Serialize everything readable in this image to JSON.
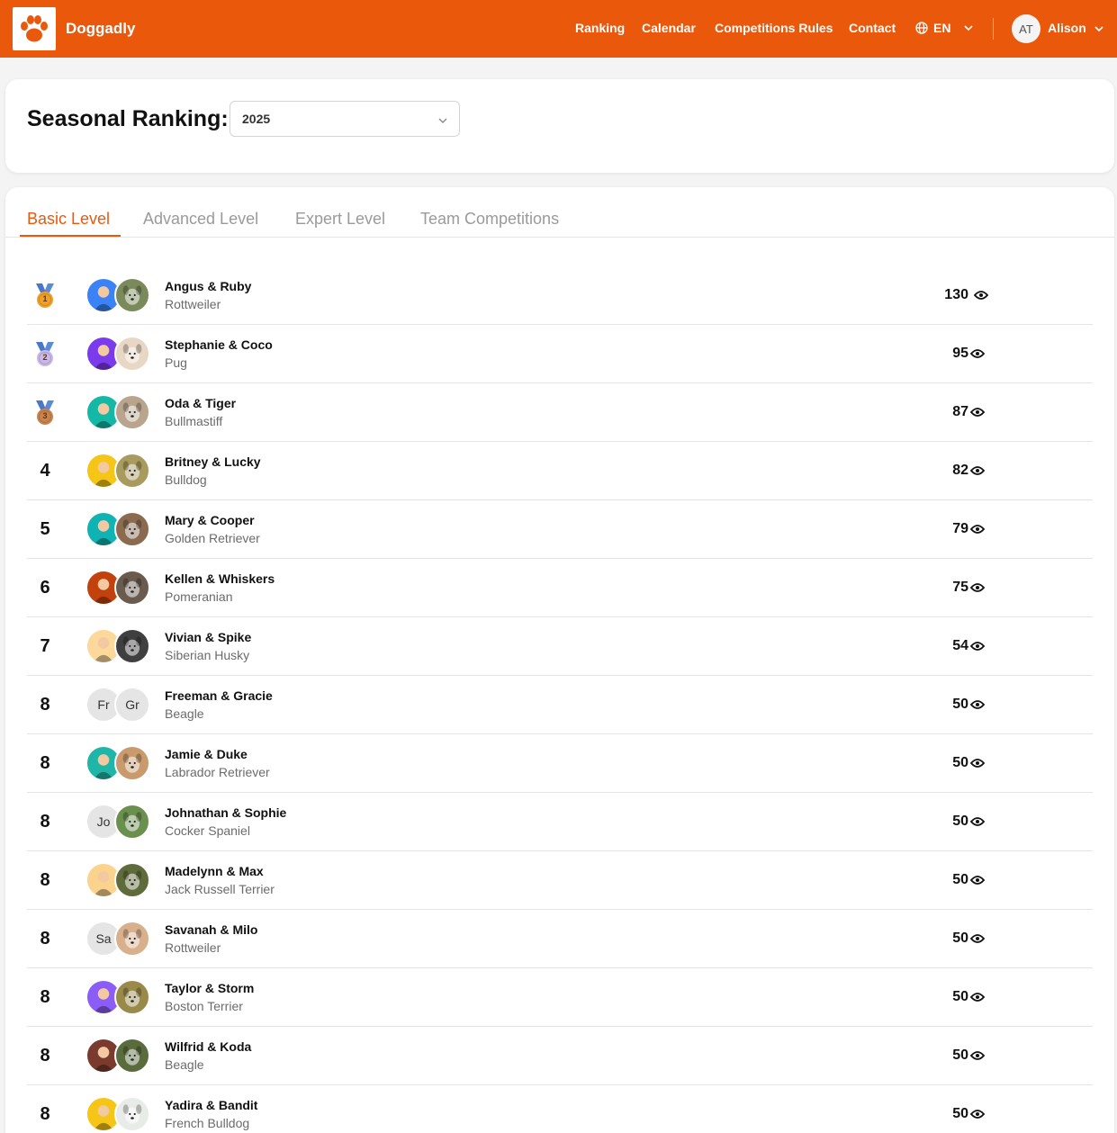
{
  "header": {
    "brand": "Doggadly",
    "nav": [
      "Ranking",
      "Calendar",
      "Competitions Rules",
      "Contact"
    ],
    "language": "EN",
    "user_initials": "AT",
    "user_name": "Alison",
    "accent": "#ea580c"
  },
  "season": {
    "label": "Seasonal Ranking:",
    "selected": "2025"
  },
  "tabs": [
    "Basic Level",
    "Advanced Level",
    "Expert Level",
    "Team Competitions"
  ],
  "active_tab": "Basic Level",
  "rows": [
    {
      "rank": "1",
      "medal": "gold",
      "names": "Angus & Ruby",
      "breed": "Rottweiler",
      "score": "130",
      "owner_initials": "",
      "dog_initials": ""
    },
    {
      "rank": "2",
      "medal": "silver",
      "names": "Stephanie & Coco",
      "breed": "Pug",
      "score": "95",
      "owner_initials": "",
      "dog_initials": ""
    },
    {
      "rank": "3",
      "medal": "bronze",
      "names": "Oda & Tiger",
      "breed": "Bullmastiff",
      "score": "87",
      "owner_initials": "",
      "dog_initials": ""
    },
    {
      "rank": "4",
      "medal": "",
      "names": "Britney & Lucky",
      "breed": "Bulldog",
      "score": "82",
      "owner_initials": "",
      "dog_initials": ""
    },
    {
      "rank": "5",
      "medal": "",
      "names": "Mary & Cooper",
      "breed": "Golden Retriever",
      "score": "79",
      "owner_initials": "",
      "dog_initials": ""
    },
    {
      "rank": "6",
      "medal": "",
      "names": "Kellen & Whiskers",
      "breed": "Pomeranian",
      "score": "75",
      "owner_initials": "",
      "dog_initials": ""
    },
    {
      "rank": "7",
      "medal": "",
      "names": "Vivian & Spike",
      "breed": "Siberian Husky",
      "score": "54",
      "owner_initials": "",
      "dog_initials": ""
    },
    {
      "rank": "8",
      "medal": "",
      "names": "Freeman & Gracie",
      "breed": "Beagle",
      "score": "50",
      "owner_initials": "Fr",
      "dog_initials": "Gr"
    },
    {
      "rank": "8",
      "medal": "",
      "names": "Jamie & Duke",
      "breed": "Labrador Retriever",
      "score": "50",
      "owner_initials": "",
      "dog_initials": ""
    },
    {
      "rank": "8",
      "medal": "",
      "names": "Johnathan & Sophie",
      "breed": "Cocker Spaniel",
      "score": "50",
      "owner_initials": "Jo",
      "dog_initials": ""
    },
    {
      "rank": "8",
      "medal": "",
      "names": "Madelynn & Max",
      "breed": "Jack Russell Terrier",
      "score": "50",
      "owner_initials": "",
      "dog_initials": ""
    },
    {
      "rank": "8",
      "medal": "",
      "names": "Savanah & Milo",
      "breed": "Rottweiler",
      "score": "50",
      "owner_initials": "Sa",
      "dog_initials": ""
    },
    {
      "rank": "8",
      "medal": "",
      "names": "Taylor & Storm",
      "breed": "Boston Terrier",
      "score": "50",
      "owner_initials": "",
      "dog_initials": ""
    },
    {
      "rank": "8",
      "medal": "",
      "names": "Wilfrid & Koda",
      "breed": "Beagle",
      "score": "50",
      "owner_initials": "",
      "dog_initials": ""
    },
    {
      "rank": "8",
      "medal": "",
      "names": "Yadira & Bandit",
      "breed": "French Bulldog",
      "score": "50",
      "owner_initials": "",
      "dog_initials": ""
    }
  ],
  "owner_colors": [
    "#3b82f6",
    "#7c3aed",
    "#14b8a6",
    "#f5c518",
    "#10b3b3",
    "#c2410c",
    "#fcd89a",
    "#e5e5e5",
    "#1fb5a8",
    "#e5e5e5",
    "#fbd38d",
    "#e5e5e5",
    "#8b5cf6",
    "#7a3b2e",
    "#f5c518"
  ],
  "dog_colors": [
    "#7a8a5a",
    "#e8d7c4",
    "#b9a58e",
    "#a99a5d",
    "#8a6b50",
    "#6b5a4e",
    "#3f3f3f",
    "#e5e5e5",
    "#c99a6b",
    "#6b8f4e",
    "#5f6b3a",
    "#d9b08c",
    "#9a8a4a",
    "#5a6b3e",
    "#e8ece8"
  ]
}
